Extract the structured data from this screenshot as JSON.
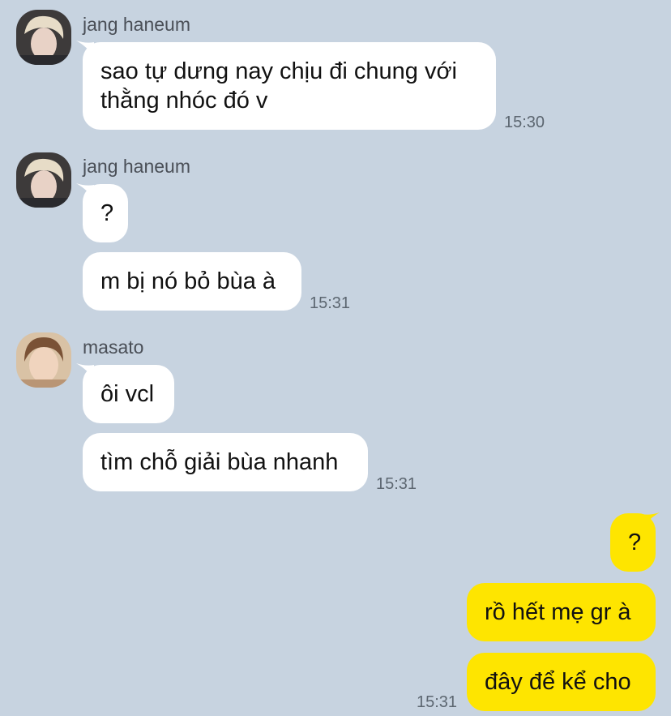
{
  "messages": [
    {
      "sender": "jang haneum",
      "text_lines": [
        "sao tự dưng nay chịu đi chung với",
        "thằng nhóc đó v"
      ],
      "time": "15:30"
    },
    {
      "sender": "jang haneum",
      "texts": [
        "?",
        "m bị nó bỏ bùa à"
      ],
      "time": "15:31"
    },
    {
      "sender": "masato",
      "texts": [
        "ôi vcl",
        "tìm chỗ giải bùa nhanh"
      ],
      "time": "15:31"
    },
    {
      "sender": "me",
      "texts": [
        "?",
        "rồ hết mẹ gr à",
        "đây để kể cho"
      ],
      "time": "15:31"
    }
  ],
  "colors": {
    "background": "#c7d3e0",
    "incoming_bubble": "#ffffff",
    "outgoing_bubble": "#fee500"
  },
  "icons": {
    "avatar_1": "profile-photo-blond-hair",
    "avatar_2": "profile-photo-brown-hair"
  }
}
